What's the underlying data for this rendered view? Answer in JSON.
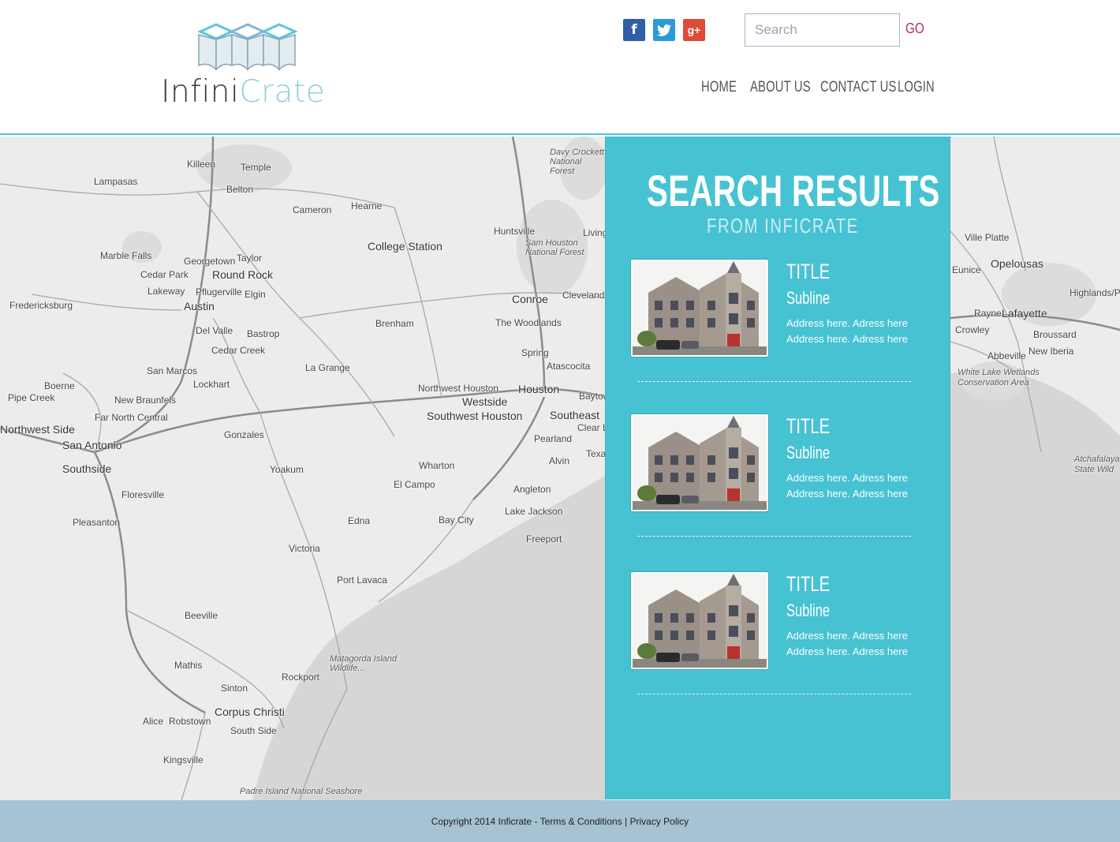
{
  "brand": {
    "name_part1": "Infini",
    "name_part2": "Crate"
  },
  "social": {
    "facebook": "f",
    "twitter": "t",
    "googleplus": "g+"
  },
  "search": {
    "placeholder": "Search",
    "go_label": "GO"
  },
  "nav": {
    "items": [
      {
        "label": "HOME"
      },
      {
        "label": "ABOUT US"
      },
      {
        "label": "CONTACT US"
      },
      {
        "label": "LOGIN"
      }
    ]
  },
  "map": {
    "labels": [
      "Killeen",
      "Temple",
      "Belton",
      "Lampasas",
      "Cameron",
      "Hearne",
      "Huntsville",
      "Livingston",
      "Sam Houston National Forest",
      "Davy Crockett National Forest",
      "College Station",
      "Marble Falls",
      "Georgetown",
      "Taylor",
      "Cedar Park",
      "Round Rock",
      "Lakeway",
      "Pflugerville",
      "Elgin",
      "Austin",
      "Fredericksburg",
      "Del Valle",
      "Bastrop",
      "Cedar Creek",
      "Brenham",
      "Conroe",
      "Cleveland",
      "The Woodlands",
      "Spring",
      "Atascocita",
      "San Marcos",
      "La Grange",
      "Lockhart",
      "Boerne",
      "New Braunfels",
      "Pipe Creek",
      "Far North Central",
      "Northwest Houston",
      "Houston",
      "Westside",
      "Southwest Houston",
      "Southeast",
      "Clear Lake",
      "Pearland",
      "Baytown",
      "Gonzales",
      "Northwest Side",
      "San Antonio",
      "Southside",
      "Yoakum",
      "Wharton",
      "El Campo",
      "Alvin",
      "Texas City",
      "Floresville",
      "Angleton",
      "Pleasanton",
      "Edna",
      "Bay City",
      "Lake Jackson",
      "Freeport",
      "Victoria",
      "Port Lavaca",
      "Beeville",
      "Matagorda Island Wildlife...",
      "Mathis",
      "Rockport",
      "Sinton",
      "Corpus Christi",
      "Alice",
      "Robstown",
      "South Side",
      "Kingsville",
      "Padre Island National Seashore",
      "Ville Platte",
      "Opelousas",
      "Eunice",
      "Highlands/Pe",
      "Rayne",
      "Lafayette",
      "Crowley",
      "Broussard",
      "Abbeville",
      "New Iberia",
      "White Lake Wetlands Conservation Area",
      "Atchafalaya State Wild"
    ]
  },
  "results": {
    "title": "SEARCH RESULTS",
    "subtitle": "FROM INFICRATE",
    "items": [
      {
        "title": "TITLE",
        "subline": "Subline",
        "address1": "Address here. Adress here",
        "address2": "Address here. Adress here"
      },
      {
        "title": "TITLE",
        "subline": "Subline",
        "address1": "Address here. Adress here",
        "address2": "Address here. Adress here"
      },
      {
        "title": "TITLE",
        "subline": "Subline",
        "address1": "Address here. Adress here",
        "address2": "Address here. Adress here"
      }
    ]
  },
  "footer": {
    "copyright": "Copyright 2014 Inficrate - ",
    "terms": "Terms & Conditions",
    "separator": " | ",
    "privacy": "Privacy Policy"
  },
  "colors": {
    "accent": "#47c2d3",
    "footer_bg": "#a5c3d2",
    "go": "#b52b5a"
  }
}
